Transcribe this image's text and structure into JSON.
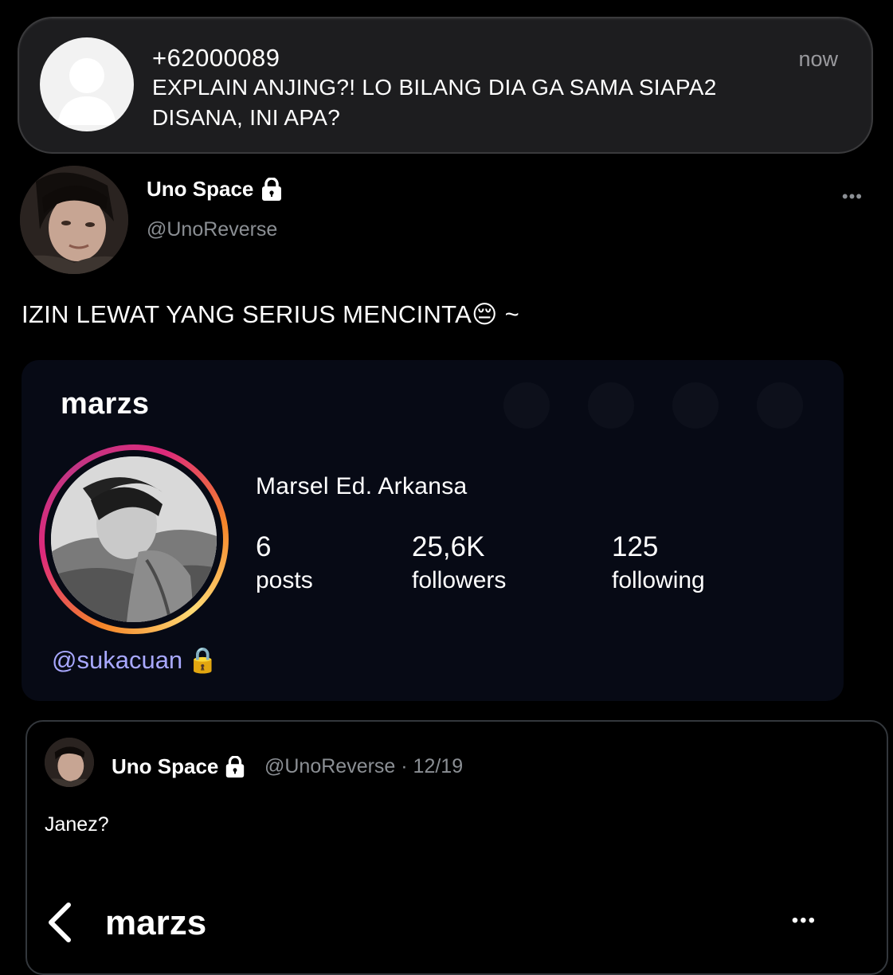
{
  "notification": {
    "sender": "+62000089",
    "message": "EXPLAIN ANJING?! LO BILANG DIA GA SAMA SIAPA2 DISANA, INI APA?",
    "time": "now"
  },
  "tweet": {
    "display_name": "Uno Space",
    "handle": "@UnoReverse",
    "more": "•••",
    "text": "IZIN LEWAT YANG SERIUS MENCINTA😔 ~"
  },
  "profile_card": {
    "username": "marzs",
    "full_name": "Marsel Ed. Arkansa",
    "stats": [
      {
        "value": "6",
        "label": "posts"
      },
      {
        "value": "25,6K",
        "label": "followers"
      },
      {
        "value": "125",
        "label": "following"
      }
    ],
    "handle": "@sukacuan",
    "handle_icon": "🔒"
  },
  "quoted_tweet": {
    "display_name": "Uno Space",
    "meta": "@UnoReverse · 12/19",
    "text": "Janez?",
    "page_title": "marzs",
    "more": "•••"
  },
  "colors": {
    "background": "#000000",
    "notification_bg": "#1d1d1f",
    "secondary_text": "#8b8f94",
    "card_bg": "#070a15",
    "handle_link": "#a8a8ff"
  }
}
